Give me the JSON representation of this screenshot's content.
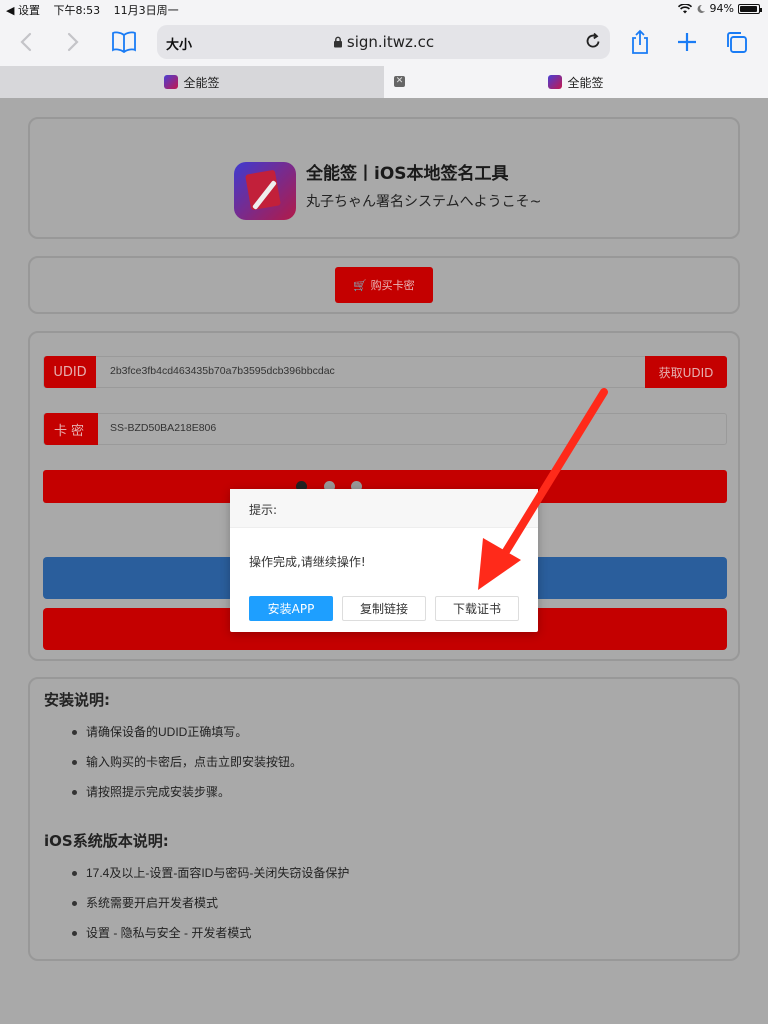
{
  "status_bar": {
    "back_app": "◀ 设置",
    "time": "下午8:53",
    "date": "11月3日周一",
    "battery": "94%",
    "battery_level": 0.94
  },
  "toolbar": {
    "text_size": "大小",
    "host": "sign.itwz.cc"
  },
  "tabs": [
    {
      "title": "全能签"
    },
    {
      "title": "全能签"
    }
  ],
  "header": {
    "title": "全能签丨iOS本地签名工具",
    "subtitle": "丸子ちゃん署名システムへようこそ~"
  },
  "buy": {
    "label": "🛒 购买卡密"
  },
  "form": {
    "udid_label": "UDID",
    "udid_value": "2b3fce3fb4cd463435b70a7b3595dcb396bbcdac",
    "get_udid_label": "获取UDID",
    "key_label": "卡密",
    "key_value": "SS-BZD50BA218E806"
  },
  "install_notes": {
    "title": "安装说明:",
    "items": [
      "请确保设备的UDID正确填写。",
      "输入购买的卡密后，点击立即安装按钮。",
      "请按照提示完成安装步骤。"
    ]
  },
  "ios_notes": {
    "title": "iOS系统版本说明:",
    "items": [
      "17.4及以上-设置-面容ID与密码-关闭失窃设备保护",
      "系统需要开启开发者模式",
      "设置 - 隐私与安全 - 开发者模式"
    ]
  },
  "dialog": {
    "title": "提示:",
    "message": "操作完成,请继续操作!",
    "install_label": "安装APP",
    "copy_label": "复制链接",
    "download_label": "下载证书"
  },
  "colors": {
    "accent_red": "#c40000",
    "accent_blue": "#2a5e9c",
    "dialog_primary": "#1e9fff",
    "annotation_arrow": "#ff2a1a"
  }
}
